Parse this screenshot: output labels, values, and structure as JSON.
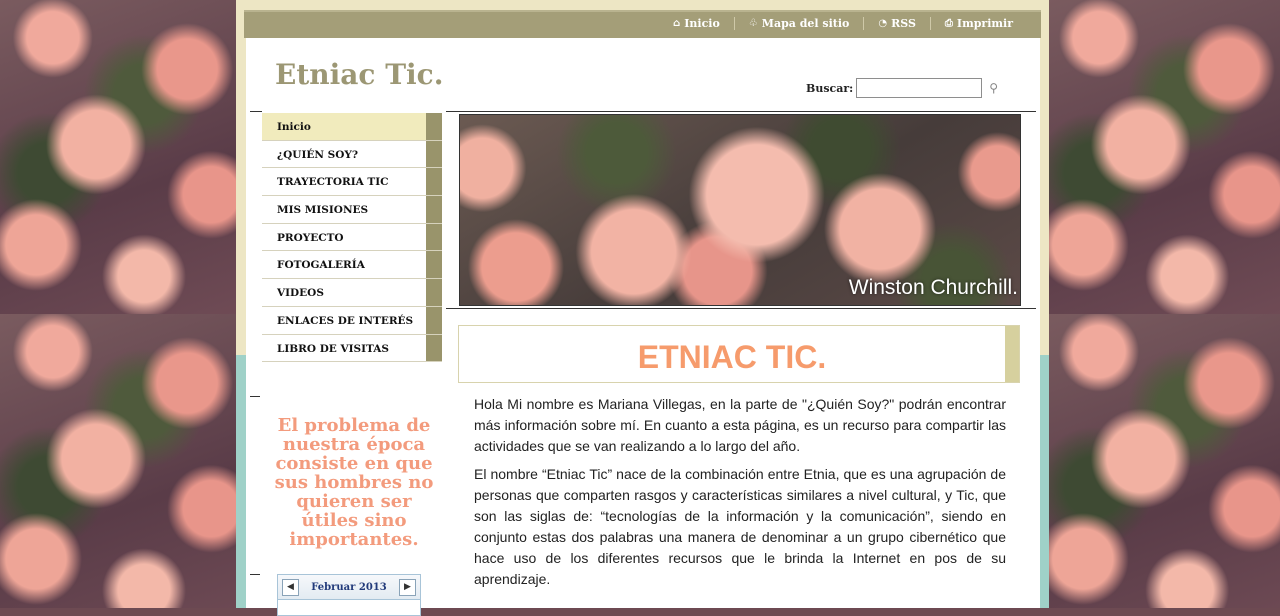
{
  "topnav": [
    {
      "label": "Inicio",
      "icon": "home-icon",
      "glyph": "⌂"
    },
    {
      "label": "Mapa del sitio",
      "icon": "sitemap-icon",
      "glyph": "♧"
    },
    {
      "label": "RSS",
      "icon": "rss-icon",
      "glyph": "◔"
    },
    {
      "label": "Imprimir",
      "icon": "print-icon",
      "glyph": "⎙"
    }
  ],
  "site": {
    "title": "Etniac Tic."
  },
  "search": {
    "label": "Buscar:",
    "value": "",
    "placeholder": ""
  },
  "nav": {
    "items": [
      "Inicio",
      "¿QUIÉN SOY?",
      "TRAYECTORIA TIC",
      "MIS MISIONES",
      "PROYECTO",
      "FOTOGALERÍA",
      "VIDEOS",
      "ENLACES DE INTERÉS",
      "LIBRO DE VISITAS"
    ],
    "active": 0
  },
  "quote": "El problema de nuestra época consiste en que sus hombres no quieren ser útiles sino importantes.",
  "banner": {
    "caption": "Winston Churchill."
  },
  "calendar": {
    "title": "Februar  2013",
    "prev": "◀",
    "next": "▶"
  },
  "content": {
    "heading": "ETNIAC TIC.",
    "paragraphs": [
      "Hola Mi nombre es Mariana Villegas, en la parte de \"¿Quién Soy?\" podrán encontrar más información sobre mí. En cuanto a esta página, es un recurso para compartir las actividades que se van realizando a lo largo del año.",
      "El nombre “Etniac Tic” nace de la combinación entre Etnia, que es una agrupación de personas que comparten rasgos y características similares a nivel cultural, y Tic, que son las siglas de: “tecnologías de la información y la comunicación”, siendo en conjunto estas dos palabras una manera de denominar a un grupo cibernético que hace uso de los diferentes recursos que le brinda la Internet en pos de su aprendizaje."
    ]
  },
  "colors": {
    "accent": "#a49e78",
    "heading": "#f69b6c",
    "quote": "#f39b7d",
    "nav_active": "#f1ebbd"
  }
}
